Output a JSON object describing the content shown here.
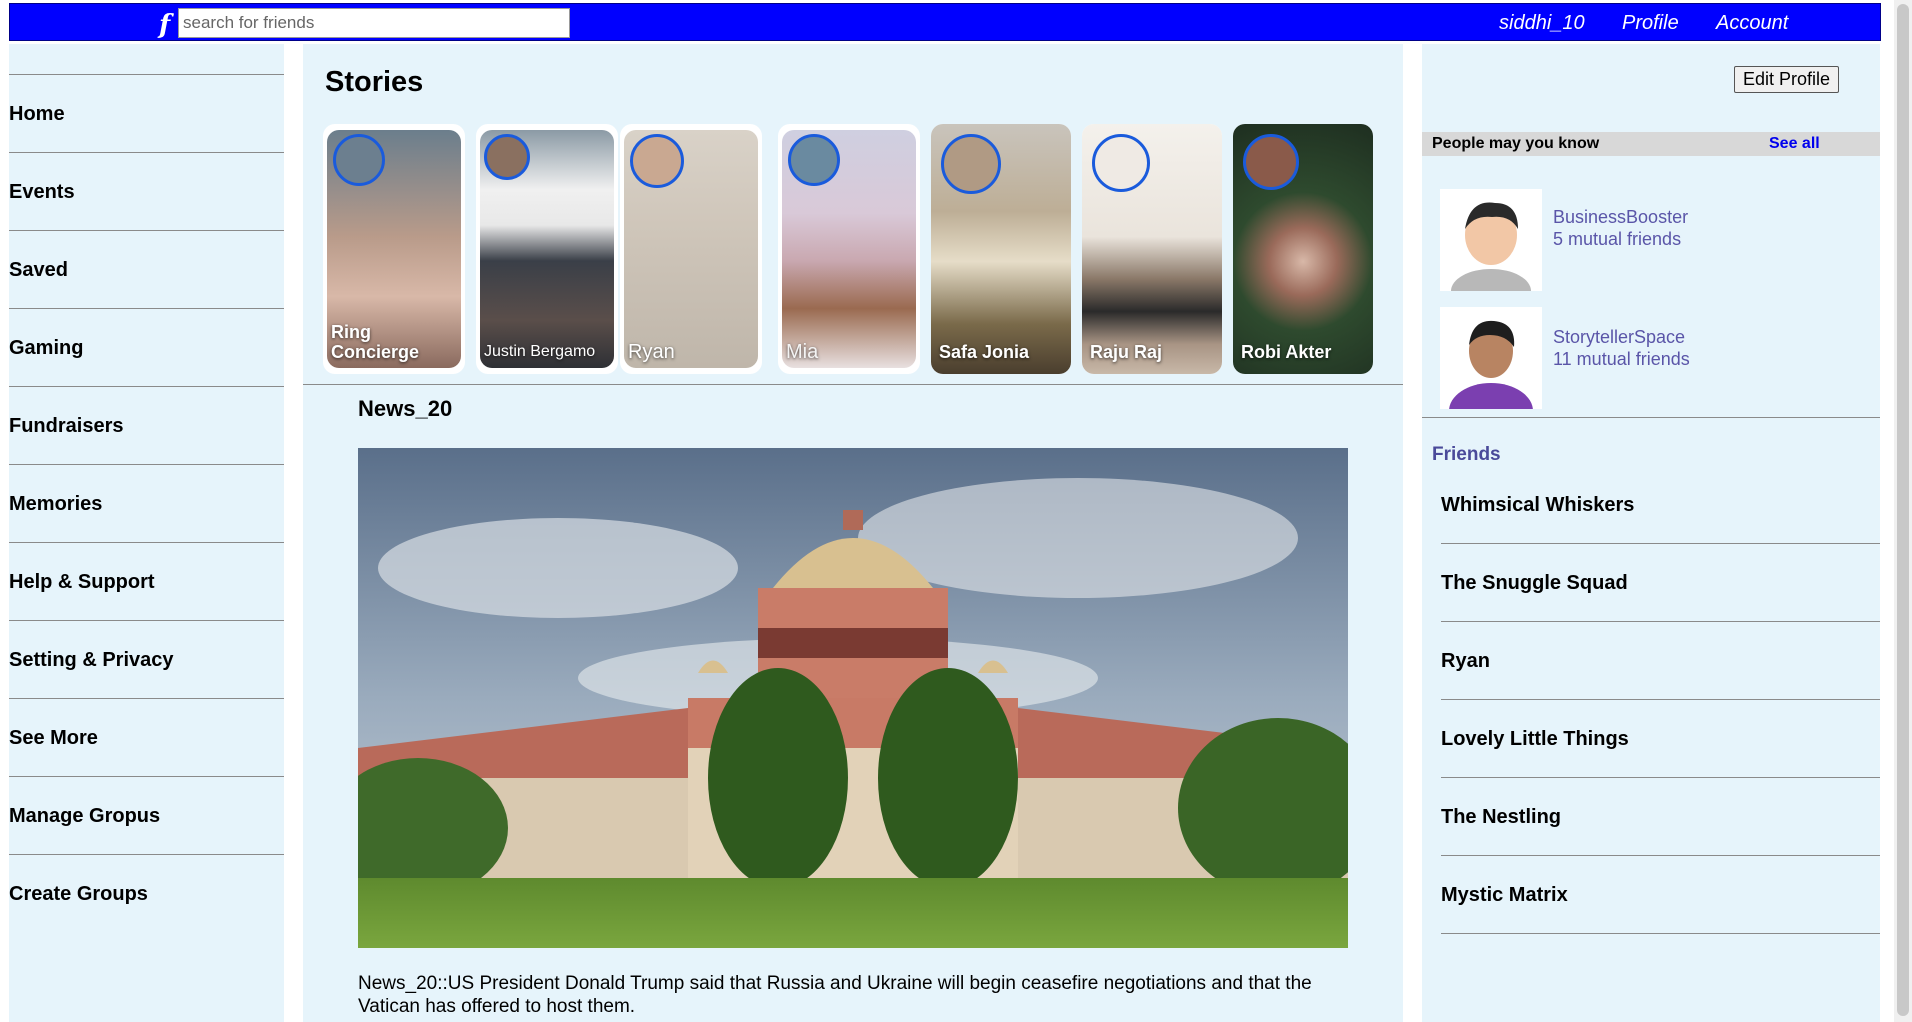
{
  "header": {
    "logo": "f",
    "search_placeholder": "search for friends",
    "username": "siddhi_10",
    "profile_label": "Profile",
    "account_label": "Account"
  },
  "sidebar": {
    "items": [
      {
        "label": "Home"
      },
      {
        "label": "Events"
      },
      {
        "label": "Saved"
      },
      {
        "label": "Gaming"
      },
      {
        "label": "Fundraisers"
      },
      {
        "label": "Memories"
      },
      {
        "label": "Help & Support"
      },
      {
        "label": "Setting & Privacy"
      },
      {
        "label": "See More"
      },
      {
        "label": "Manage Gropus"
      },
      {
        "label": "Create Groups"
      }
    ]
  },
  "stories": {
    "title": "Stories",
    "items": [
      {
        "name": "Ring Concierge"
      },
      {
        "name": "Justin Bergamo"
      },
      {
        "name": "Ryan"
      },
      {
        "name": "Mia"
      },
      {
        "name": "Safa Jonia"
      },
      {
        "name": "Raju Raj"
      },
      {
        "name": "Robi Akter"
      }
    ]
  },
  "post": {
    "title": "News_20",
    "text": "News_20::US President Donald Trump said that Russia and Ukraine will begin ceasefire negotiations and that the Vatican has offered to host them."
  },
  "right": {
    "edit_profile_label": "Edit Profile",
    "pymk_title": "People may you know",
    "see_all_label": "See all",
    "suggestions": [
      {
        "name": "BusinessBooster",
        "mutual": "5 mutual friends"
      },
      {
        "name": "StorytellerSpace",
        "mutual": "11 mutual friends"
      }
    ],
    "friends_title": "Friends",
    "friends": [
      {
        "name": "Whimsical Whiskers"
      },
      {
        "name": "The Snuggle Squad"
      },
      {
        "name": "Ryan"
      },
      {
        "name": "Lovely Little Things"
      },
      {
        "name": "The Nestling"
      },
      {
        "name": "Mystic Matrix"
      }
    ]
  },
  "colors": {
    "topbar": "#0000ff",
    "panel": "#e6f4fb",
    "story_ring": "#1a5bdc",
    "link": "#5a55a8"
  }
}
